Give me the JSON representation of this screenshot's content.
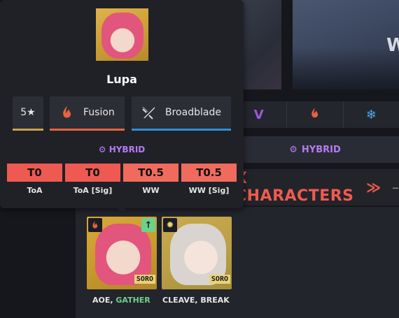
{
  "popup": {
    "character_name": "Lupa",
    "rarity_label": "5★",
    "element": {
      "icon": "fusion-icon",
      "label": "Fusion",
      "color": "#e7633c"
    },
    "weapon": {
      "icon": "broadblade-icon",
      "label": "Broadblade",
      "color": "#2f8ed8"
    },
    "role_label": "HYBRID",
    "role_color": "#b57bf0",
    "tiers": [
      {
        "value": "T0",
        "label": "ToA",
        "color": "#ee5a52"
      },
      {
        "value": "T0",
        "label": "ToA [Sig]",
        "color": "#ee5a52"
      },
      {
        "value": "T0.5",
        "label": "WW",
        "color": "#f06b5e"
      },
      {
        "value": "T0.5",
        "label": "WW [Sig]",
        "color": "#f06b5e"
      }
    ]
  },
  "background": {
    "banner_text": "W",
    "element_icons": [
      "spectro-v-icon",
      "fusion-icon",
      "glacio-icon"
    ],
    "role_label": "HYBRID",
    "section_title": "X CHARACTERS",
    "section_chevron": "≫",
    "section_dash": "–",
    "characters": [
      {
        "element_icon": "fusion-icon",
        "upgrade_icon": "arrow-up-icon",
        "tag": "SORO",
        "caption_main": "AOE, ",
        "caption_highlight": "GATHER"
      },
      {
        "element_icon": "spectro-icon",
        "tag": "SORO",
        "caption_main": "CLEAVE, BREAK"
      }
    ]
  }
}
